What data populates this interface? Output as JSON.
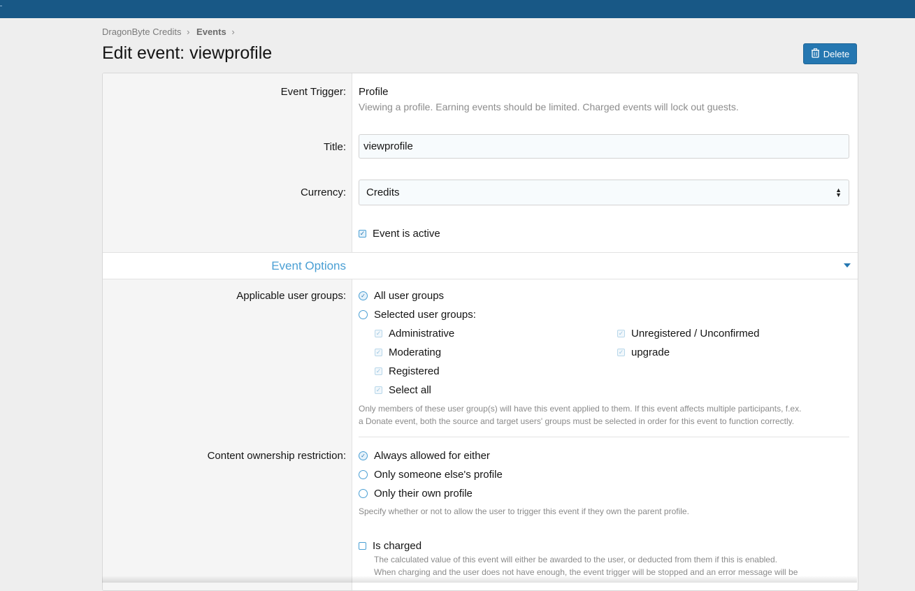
{
  "breadcrumb": {
    "items": [
      "DragonByte Credits",
      "Events"
    ]
  },
  "page": {
    "title": "Edit event: viewprofile"
  },
  "toolbar": {
    "delete_label": "Delete",
    "delete_icon": "trash-icon"
  },
  "form": {
    "trigger": {
      "label": "Event Trigger:",
      "value": "Profile",
      "description": "Viewing a profile. Earning events should be limited. Charged events will lock out guests."
    },
    "title": {
      "label": "Title:",
      "value": "viewprofile"
    },
    "currency": {
      "label": "Currency:",
      "selected": "Credits"
    },
    "active": {
      "label": "Event is active",
      "checked": true
    }
  },
  "options": {
    "section_title": "Event Options",
    "user_groups": {
      "label": "Applicable user groups:",
      "all": "All user groups",
      "selected": "Selected user groups:",
      "groups": [
        "Administrative",
        "Moderating",
        "Registered",
        "Select all",
        "Unregistered / Unconfirmed",
        "upgrade"
      ],
      "hint_line1": "Only members of these user group(s) will have this event applied to them. If this event affects multiple participants, f.ex.",
      "hint_line2": "a Donate event, both the source and target users' groups must be selected in order for this event to function correctly."
    },
    "ownership": {
      "label": "Content ownership restriction:",
      "options": [
        "Always allowed for either",
        "Only someone else's profile",
        "Only their own profile"
      ],
      "hint": "Specify whether or not to allow the user to trigger this event if they own the parent profile."
    },
    "charged": {
      "label": "Is charged",
      "checked": false,
      "hint_line1": "The calculated value of this event will either be awarded to the user, or deducted from them if this is enabled.",
      "hint_line2": "When charging and the user does not have enough, the event trigger will be stopped and an error message will be"
    }
  },
  "colors": {
    "topbar": "#185886",
    "accent": "#2577b1",
    "link": "#4a9fd4"
  }
}
